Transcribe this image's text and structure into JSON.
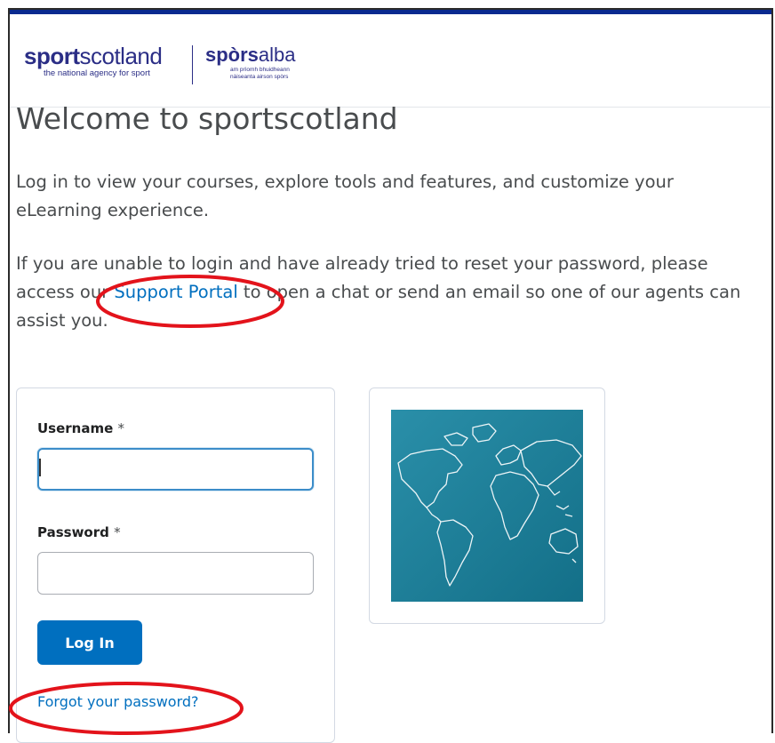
{
  "header": {
    "logo_en_bold": "sport",
    "logo_en_light": "scotland",
    "logo_en_tagline": "the national agency for sport",
    "logo_ga_bold": "spòrs",
    "logo_ga_light": "alba",
    "logo_ga_tagline_1": "am prìomh bhuidheann",
    "logo_ga_tagline_2": "nàiseanta airson spòrs"
  },
  "main": {
    "title": "Welcome to sportscotland",
    "intro": "Log in to view your courses, explore tools and features, and customize your eLearning experience.",
    "support_before": "If you are unable to login and have already tried to reset your password, please access our ",
    "support_link": "Support Portal",
    "support_after": " to open a chat or send an email so one of our agents can assist you."
  },
  "login": {
    "username_label": "Username",
    "password_label": "Password",
    "required_mark": "*",
    "username_value": "",
    "password_value": "",
    "login_button": "Log In",
    "forgot_link": "Forgot your password?"
  },
  "colors": {
    "brand_navy": "#2b2e86",
    "link_blue": "#006fbf",
    "annotation_red": "#e3131b",
    "map_teal": "#1c7f99"
  }
}
